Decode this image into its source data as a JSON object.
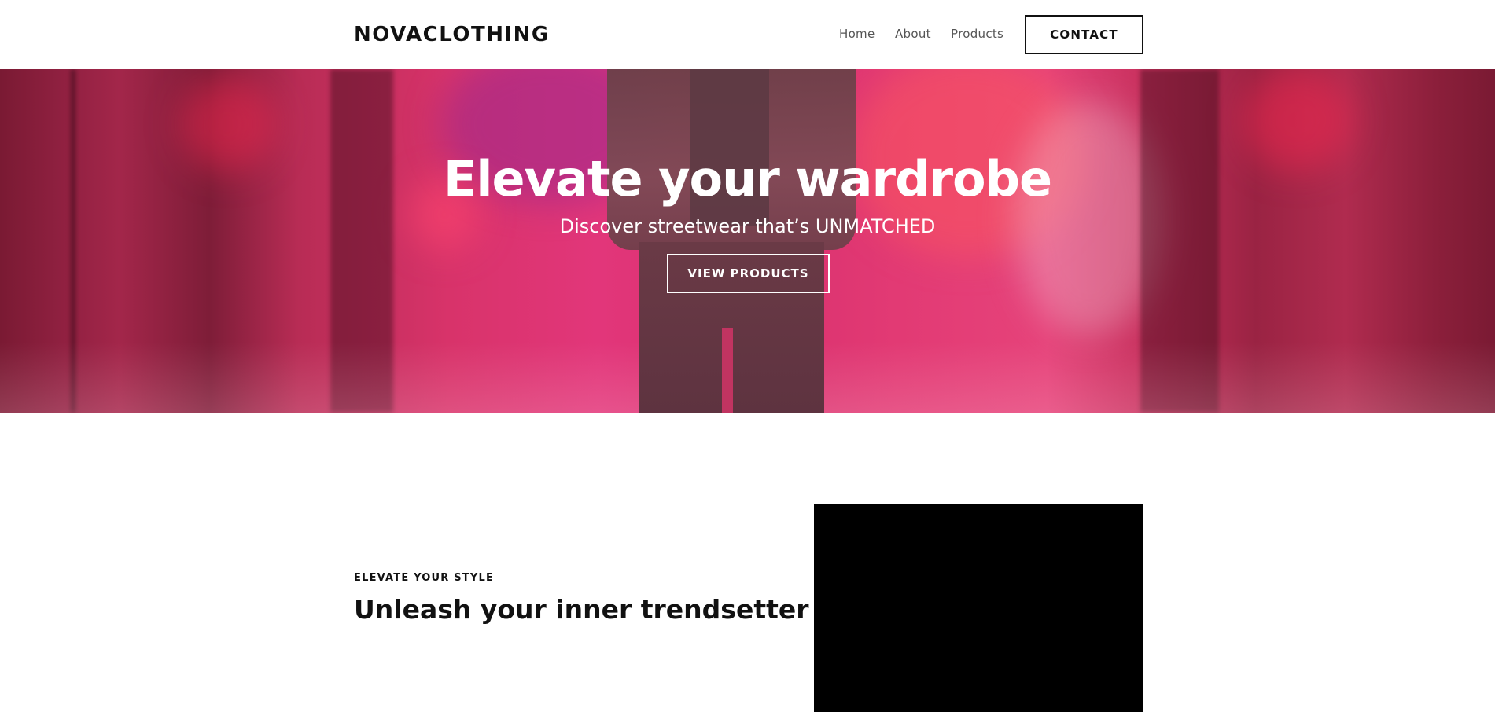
{
  "header": {
    "logo": "NOVACLOTHING",
    "nav": [
      {
        "label": "Home"
      },
      {
        "label": "About"
      },
      {
        "label": "Products"
      }
    ],
    "contact_label": "CONTACT"
  },
  "hero": {
    "title": "Elevate your wardrobe",
    "subtitle": "Discover streetwear that’s UNMATCHED",
    "cta_label": "VIEW PRODUCTS",
    "overlay_color": "#e0336d"
  },
  "about": {
    "eyebrow": "ELEVATE YOUR STYLE",
    "heading": "Unleash your inner trendsetter",
    "media_color": "#000000"
  }
}
